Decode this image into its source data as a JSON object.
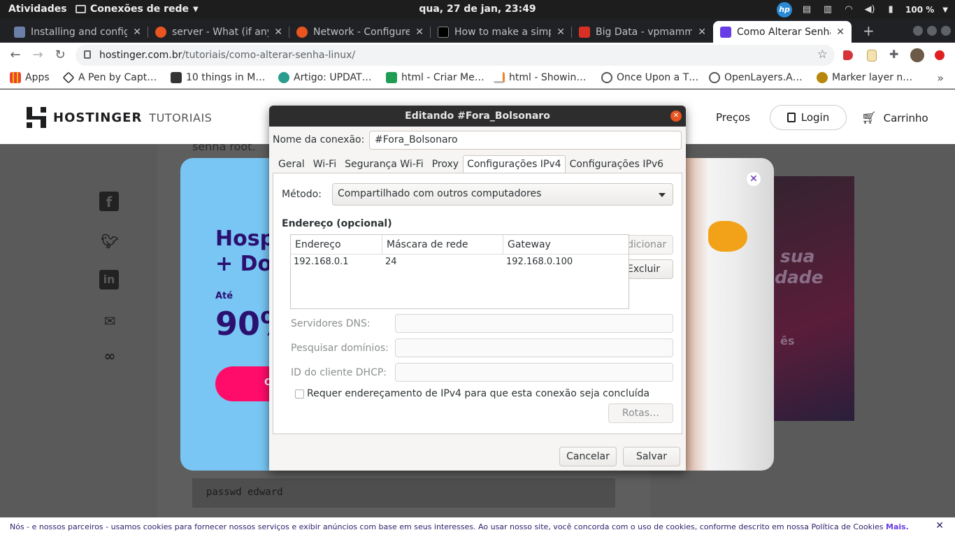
{
  "topbar": {
    "activities": "Atividades",
    "app_name": "Conexões de rede",
    "clock": "qua, 27 de jan, 23:49",
    "hp": "hp",
    "battery": "100 %"
  },
  "tabs": [
    {
      "title": "Installing and config",
      "favicon_color": "#6b7fa8"
    },
    {
      "title": "server - What (if anyt",
      "favicon_color": "#e95420"
    },
    {
      "title": "Network - Configure",
      "favicon_color": "#e95420"
    },
    {
      "title": "How to make a simp",
      "favicon_color": "#000000"
    },
    {
      "title": "Big Data - vpmamma",
      "favicon_color": "#d93025"
    },
    {
      "title": "Como Alterar Senha",
      "favicon_color": "#673de6"
    }
  ],
  "address": {
    "url_host": "hostinger.com.br",
    "url_path": "/tutoriais/como-alterar-senha-linux/"
  },
  "bookmarks": [
    {
      "label": "Apps",
      "color": "#4285f4"
    },
    {
      "label": "A Pen by Capt…",
      "color": "#222222"
    },
    {
      "label": "10 things in M…",
      "color": "#333333"
    },
    {
      "label": "Artigo: UPDAT…",
      "color": "#2a9d8f"
    },
    {
      "label": "html - Criar Me…",
      "color": "#1f9d55"
    },
    {
      "label": "html - Showin…",
      "color": "#f48024"
    },
    {
      "label": "Once Upon a T…",
      "color": "#555555"
    },
    {
      "label": "OpenLayers.A…",
      "color": "#555555"
    },
    {
      "label": "Marker layer n…",
      "color": "#b8860b"
    }
  ],
  "site": {
    "brand": "HOSTINGER",
    "brand_sub": "TUTORIAIS",
    "prices": "Preços",
    "login": "Login",
    "cart": "Carrinho",
    "article_fragment": "senha root.",
    "code": "passwd edward",
    "promo_title_1": "Hosp",
    "promo_title_2": "+ Dor",
    "promo_upto": "Até",
    "promo_percent": "90%",
    "promo_cta": "C",
    "right_img_text_1": "sua",
    "right_img_text_2": "dade",
    "right_img_text_3": "ês"
  },
  "cookie": {
    "text": "Nós - e nossos parceiros - usamos cookies para fornecer nossos serviços e exibir anúncios com base em seus interesses. Ao usar nosso site, você concorda com o uso de cookies, conforme descrito em nossa Política de Cookies",
    "more": "Mais."
  },
  "dialog": {
    "title": "Editando #Fora_Bolsonaro",
    "connection_name_label": "Nome da conexão:",
    "connection_name_value": "#Fora_Bolsonaro",
    "tabs": [
      "Geral",
      "Wi-Fi",
      "Segurança Wi-Fi",
      "Proxy",
      "Configurações IPv4",
      "Configurações IPv6"
    ],
    "active_tab": "Configurações IPv4",
    "method_label": "Método:",
    "method_value": "Compartilhado com outros computadores",
    "address_section": "Endereço (opcional)",
    "columns": [
      "Endereço",
      "Máscara de rede",
      "Gateway"
    ],
    "rows": [
      {
        "address": "192.168.0.1",
        "netmask": "24",
        "gateway": "192.168.0.100"
      }
    ],
    "add_button": "Adicionar",
    "delete_button": "Excluir",
    "dns_label": "Servidores DNS:",
    "dns_value": "",
    "search_label": "Pesquisar domínios:",
    "search_value": "",
    "dhcp_label": "ID do cliente DHCP:",
    "dhcp_value": "",
    "require_ipv4_label": "Requer endereçamento de IPv4 para que esta conexão seja concluída",
    "require_ipv4_checked": false,
    "routes_button": "Rotas…",
    "cancel_button": "Cancelar",
    "save_button": "Salvar"
  }
}
